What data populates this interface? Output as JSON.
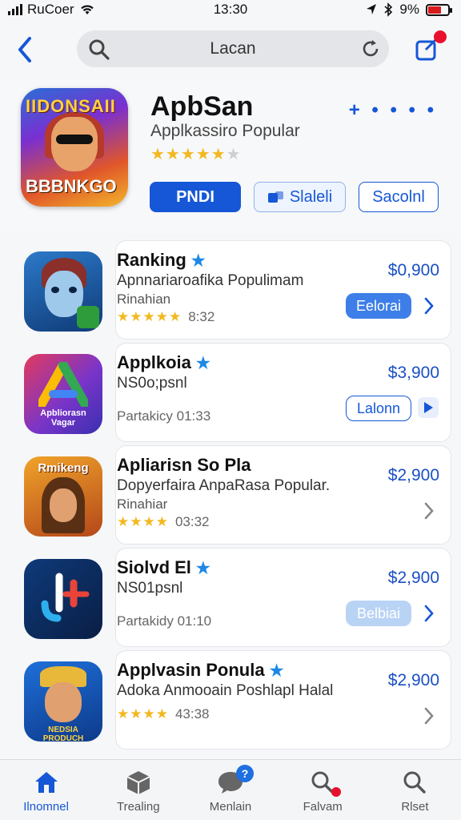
{
  "status": {
    "carrier": "RuCoer",
    "time": "13:30",
    "battery": "9%",
    "battery_level": 0.62,
    "battery_color": "#d91a1a"
  },
  "search": {
    "text": "Lacan"
  },
  "hero": {
    "icon_text_top": "IIDONSAII",
    "icon_text_bottom": "BBBNKGO",
    "title": "ApbSan",
    "subtitle": "Applkassiro Popular",
    "rating": 4.5,
    "stars_on": "★★★★★",
    "stars_off": "★",
    "more": "+ • • • •",
    "btn_primary": "PNDI",
    "btn_secondary": "Slaleli",
    "btn_tertiary": "Sacolnl"
  },
  "apps": [
    {
      "name": "Ranking",
      "desc": "Apnnariaroafika Populimam",
      "line3": "Rinahian",
      "stars": "★★★★★",
      "time": "8:32",
      "price": "$0,900",
      "button": "Eelorai",
      "button_style": "solid",
      "action": "chevron"
    },
    {
      "name": "Applkoia",
      "desc": "NS0o;psnl",
      "line3": "",
      "time": "Partakicy 01:33",
      "stars": "",
      "price": "$3,900",
      "button": "Lalonn",
      "button_style": "outline",
      "action": "play",
      "icon_text": "Apbliorasn Vagar"
    },
    {
      "name": "Apliarisn So Pla",
      "desc": "Dopyerfaira AnpaRasa Popular.",
      "line3": "Rinahiar",
      "stars": "★★★★",
      "time": "03:32",
      "price": "$2,900",
      "button": "",
      "button_style": "none",
      "action": "chevron",
      "icon_text": "Rmikeng"
    },
    {
      "name": "Siolvd El",
      "desc": "NS01psnl",
      "line3": "",
      "time": "Partakidy 01:10",
      "stars": "",
      "price": "$2,900",
      "button": "Belbiai",
      "button_style": "pale",
      "action": "chevron"
    },
    {
      "name": "Applvasin Ponula",
      "desc": "Adoka Anmooain Poshlapl Halal",
      "line3": "",
      "stars": "★★★★",
      "time": "43:38",
      "price": "$2,900",
      "button": "",
      "button_style": "none",
      "action": "chevron",
      "icon_text": "NEDSIA PRODUCH"
    }
  ],
  "tabs": [
    {
      "label": "Ilnomnel",
      "icon": "home-icon",
      "active": true
    },
    {
      "label": "Trealing",
      "icon": "box-icon",
      "active": false
    },
    {
      "label": "Menlain",
      "icon": "chat-icon",
      "active": false,
      "badge": "?"
    },
    {
      "label": "Falvam",
      "icon": "search-badge-icon",
      "active": false
    },
    {
      "label": "Rlset",
      "icon": "search-icon",
      "active": false
    }
  ],
  "colors": {
    "accent": "#1557d6",
    "star": "#f2b81f",
    "badge_red": "#e8112d"
  }
}
